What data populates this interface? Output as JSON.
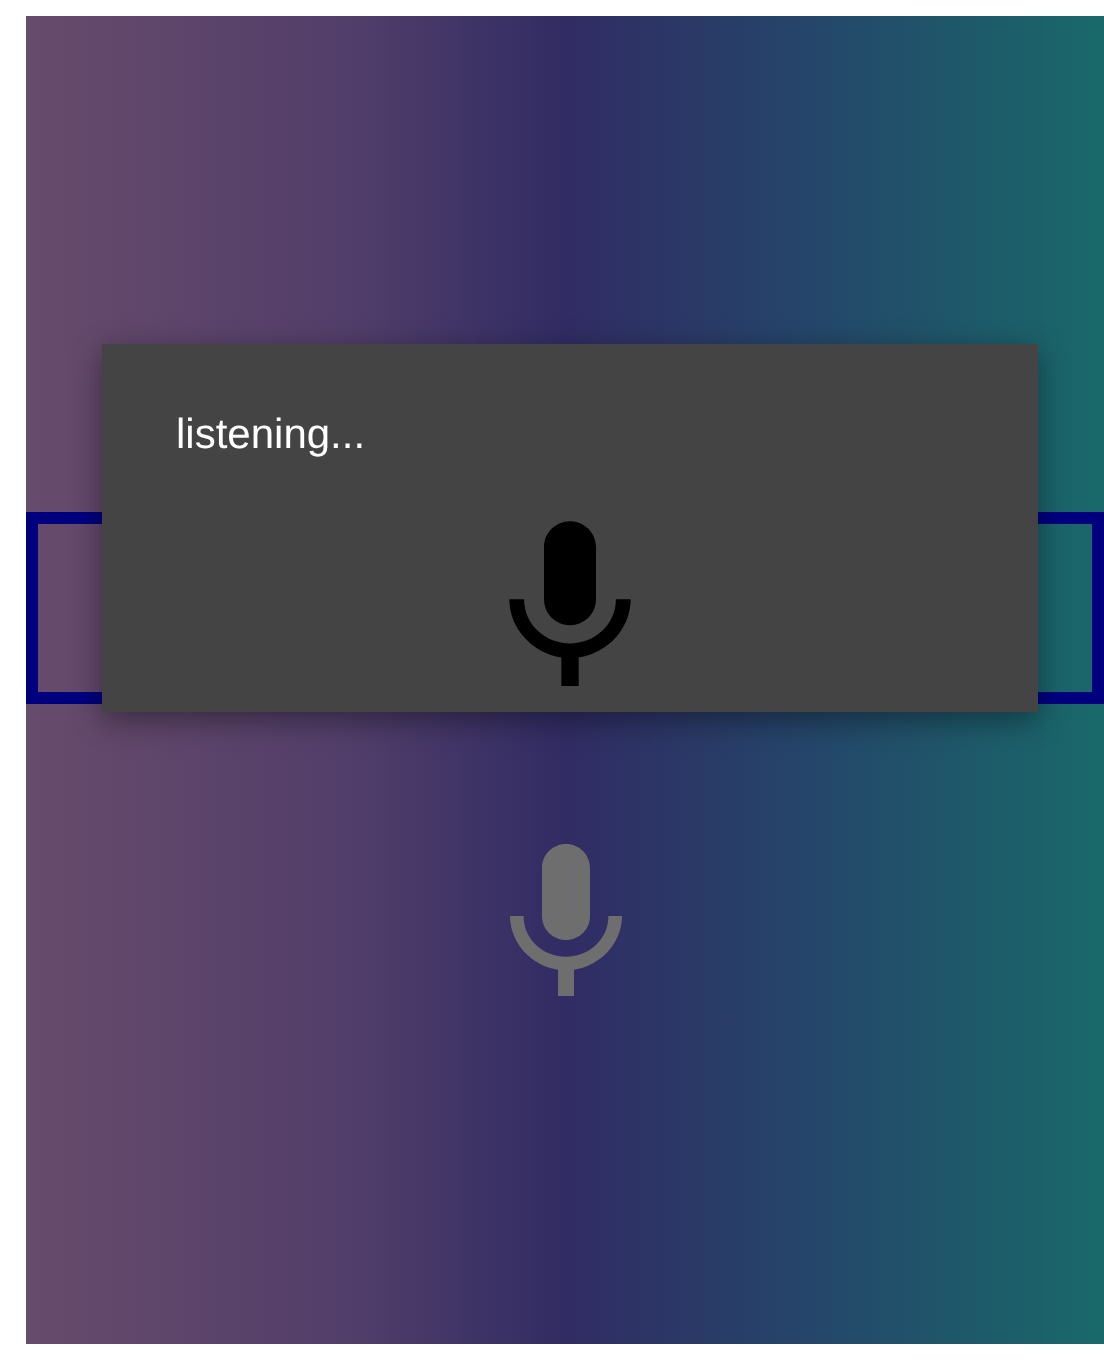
{
  "dialog": {
    "title": "listening..."
  }
}
